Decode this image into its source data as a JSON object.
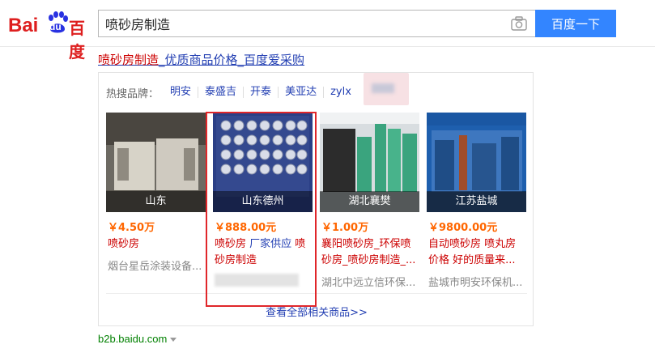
{
  "logo": {
    "bai": "Bai",
    "du": "du",
    "cn": "百度"
  },
  "search": {
    "query": "喷砂房制造",
    "button_label": "百度一下"
  },
  "ad": {
    "title_keyword": "喷砂房制造",
    "title_rest": "_优质商品价格_百度爱采购",
    "hot_brands_label": "热搜品牌：",
    "brands": [
      "明安",
      "泰盛吉",
      "开泰",
      "美亚达",
      "zylx"
    ],
    "products": [
      {
        "location": "山东",
        "price": "￥4.50万",
        "name_parts": [
          "喷砂房"
        ],
        "seller": "烟台星岳涂装设备..."
      },
      {
        "location": "山东德州",
        "price": "￥888.00元",
        "name_parts": [
          "喷砂房",
          " 厂家供应 ",
          "喷砂房制造"
        ],
        "seller": ""
      },
      {
        "location": "湖北襄樊",
        "price": "￥1.00万",
        "name_parts": [
          "襄阳喷砂房_环保喷砂房_喷砂房制造_..."
        ],
        "seller": "湖北中远立信环保..."
      },
      {
        "location": "江苏盐城",
        "price": "￥9800.00元",
        "name_parts": [
          "自动喷砂房 喷丸房价格 好的质量来..."
        ],
        "seller": "盐城市明安环保机..."
      }
    ],
    "see_all": "查看全部相关商品>>",
    "site": "b2b.baidu.com"
  },
  "colors": {
    "brand_red": "#de1f1f",
    "link_blue": "#2440b3",
    "search_blue": "#3385ff",
    "price_orange": "#ff6600",
    "highlight_red": "#e0262a"
  }
}
